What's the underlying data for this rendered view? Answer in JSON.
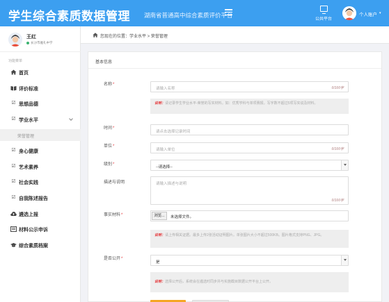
{
  "header": {
    "title": "学生综合素质数据管理",
    "subtitle": "湖南省普通高中综合素质评价平台",
    "platform_label": "公共平台",
    "user_label": "个人账户"
  },
  "sidebar": {
    "profile": {
      "name": "王红",
      "status": "长沙市雅礼中学"
    },
    "section_label": "功能菜单",
    "items": [
      {
        "label": "首页",
        "icon": "home-icon"
      },
      {
        "label": "评价标准",
        "icon": "book-icon"
      },
      {
        "label": "思想品德",
        "icon": "edit-icon"
      },
      {
        "label": "学业水平",
        "icon": "edit-icon"
      },
      {
        "label": "身心健康",
        "icon": "edit-icon"
      },
      {
        "label": "艺术素养",
        "icon": "edit-icon"
      },
      {
        "label": "社会实践",
        "icon": "edit-icon"
      },
      {
        "label": "自我陈述报告",
        "icon": "edit-icon"
      },
      {
        "label": "遴选上报",
        "icon": "cloud-upload-icon"
      },
      {
        "label": "材料公示申诉",
        "icon": "list-icon"
      },
      {
        "label": "综合素质档案",
        "icon": "graduation-cap-icon"
      }
    ],
    "sub_item": "荣誉管理"
  },
  "breadcrumb": {
    "text": "您现在的位置：学业水平 > 荣誉管理"
  },
  "form": {
    "panel_title": "基本信息",
    "clear_label": "0/100字",
    "name": {
      "label": "名称",
      "placeholder": "请输入名称"
    },
    "name_note": {
      "prefix": "说明：",
      "text": "请记录学生学业水平-荣誉的写实材料。如：优秀学科与单项赛报。写字数不超过5项写实说及材料。"
    },
    "time": {
      "label": "时间",
      "placeholder": "请点击选择记录时间"
    },
    "unit": {
      "label": "单位",
      "placeholder": "请输入单位"
    },
    "level": {
      "label": "级别",
      "value": "--请选择--"
    },
    "description": {
      "label": "描述与说明",
      "placeholder": "请输入描述与说明"
    },
    "evidence": {
      "label": "事实材料",
      "button": "浏览...",
      "status": "未选择文件。"
    },
    "evidence_note": {
      "prefix": "说明：",
      "text": "请上传相关证据。最多上传2张活动证明图片。单张图片大小不超过500KB。图片格式支持PNG、JPG。"
    },
    "public": {
      "label": "是否公开",
      "value": "是"
    },
    "public_note": {
      "prefix": "说明：",
      "text": "选择公开后，系统会在遴选时同步并与实施截目数据公开平台上公开。"
    }
  },
  "colors": {
    "topbar": "#3c9ff0",
    "required": "#e4393c",
    "primary_button": "#f5a623"
  }
}
